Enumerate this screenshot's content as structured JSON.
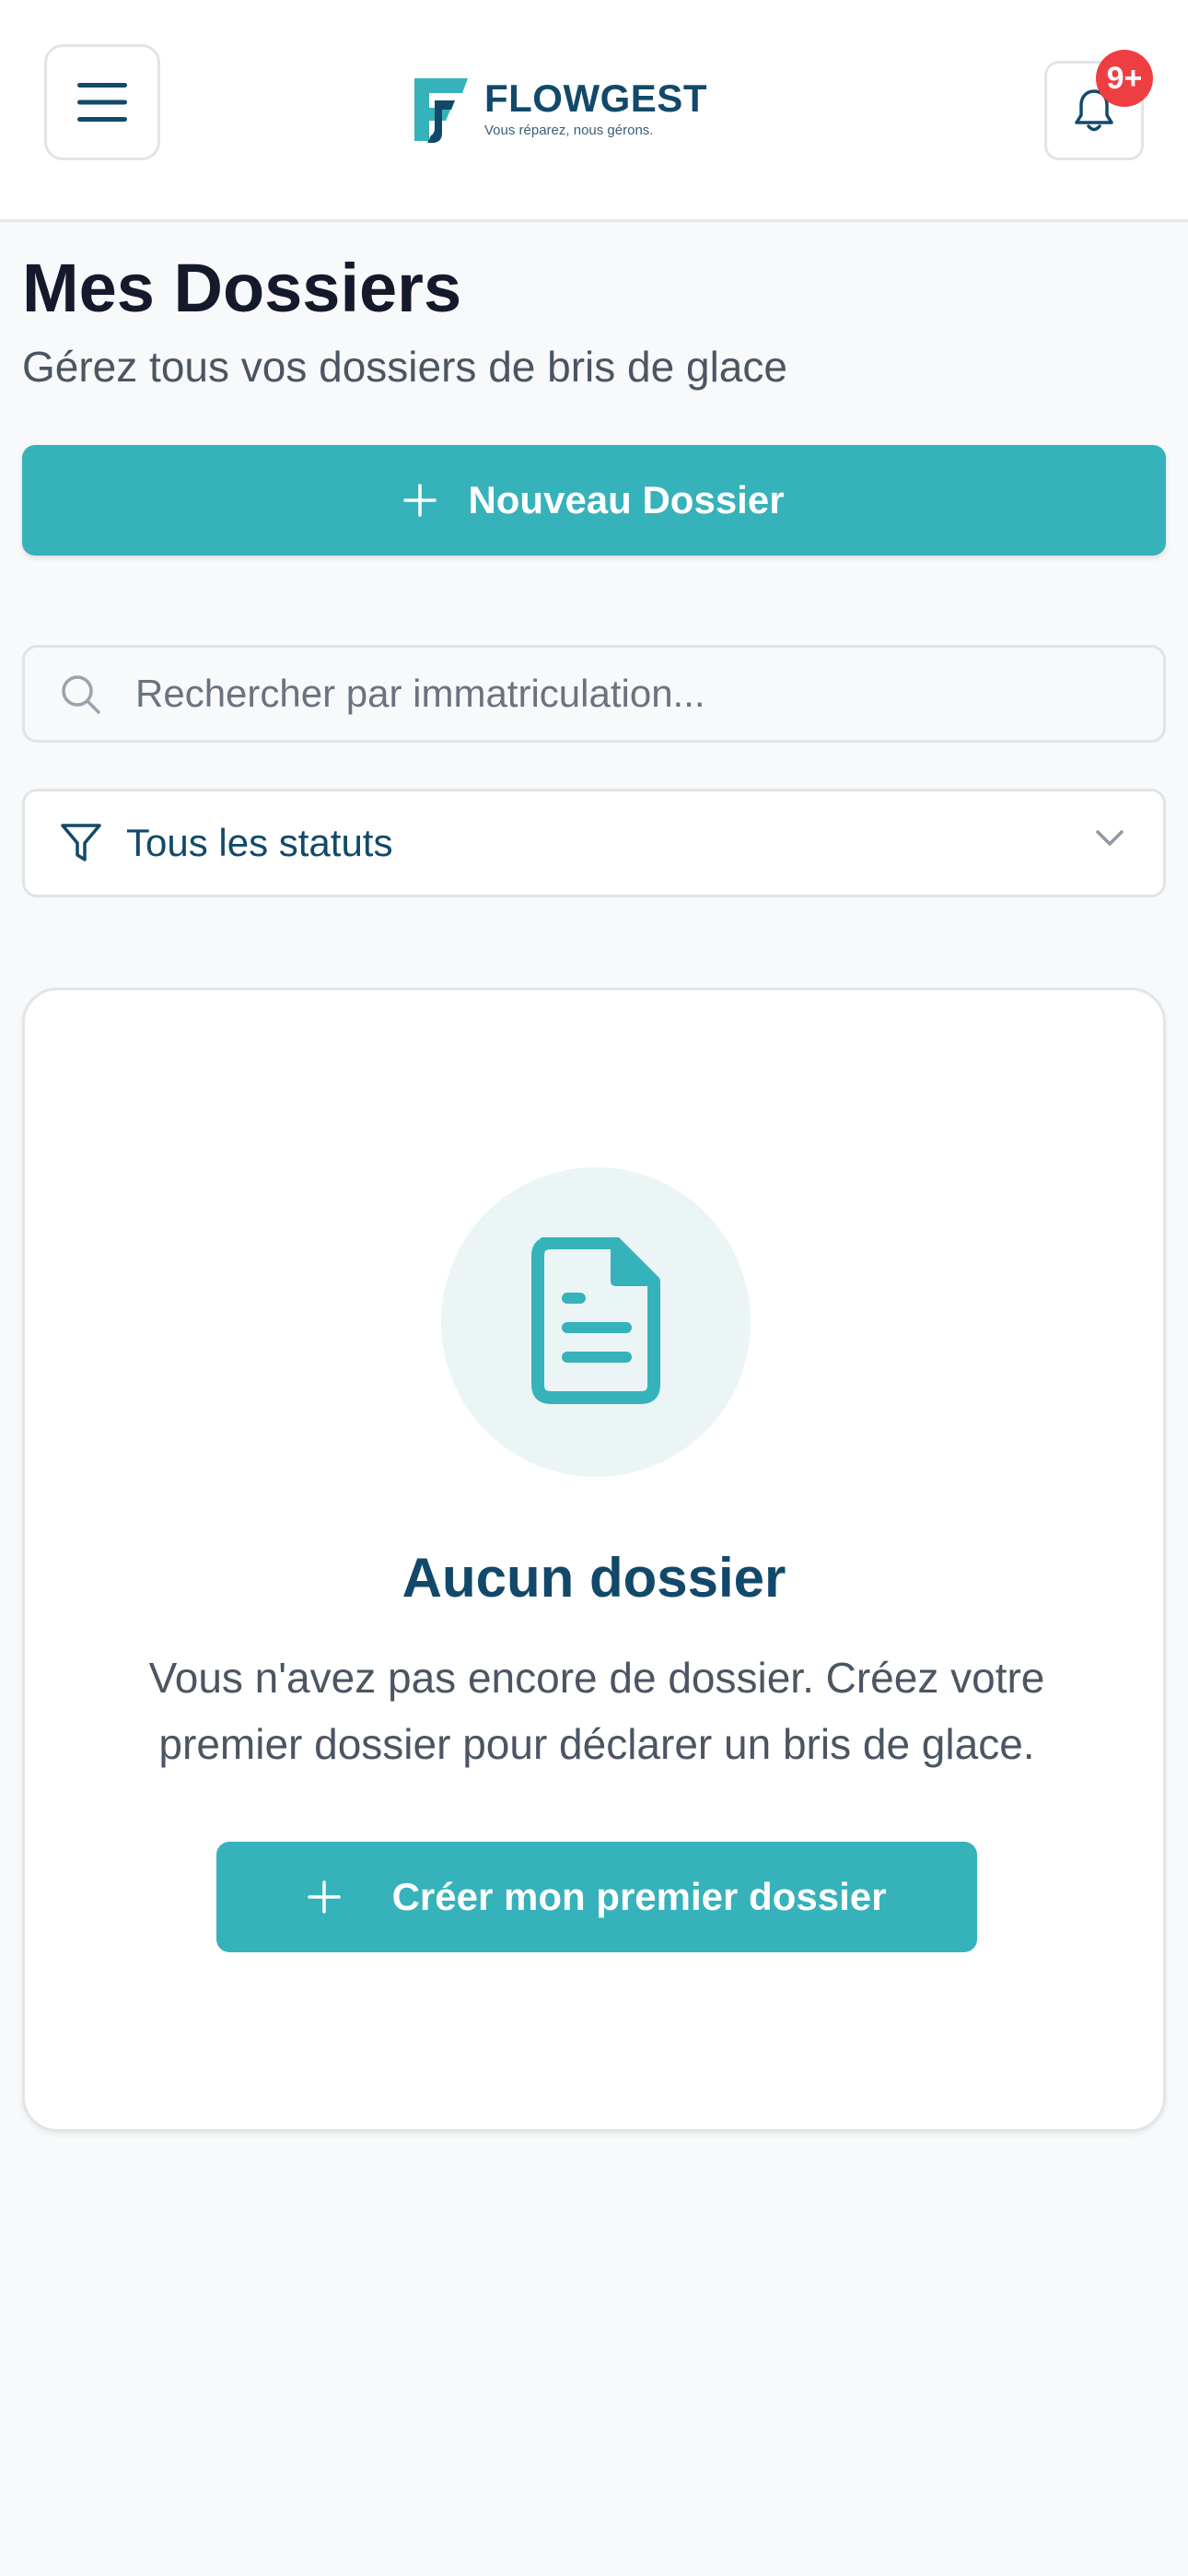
{
  "header": {
    "menu_icon": "hamburger-icon",
    "logo": {
      "name": "FLOWGEST",
      "tagline": "Vous réparez, nous gérons."
    },
    "notifications": {
      "icon": "bell-icon",
      "badge": "9+"
    }
  },
  "page": {
    "title": "Mes Dossiers",
    "subtitle": "Gérez tous vos dossiers de bris de glace"
  },
  "actions": {
    "new_folder_label": "Nouveau Dossier",
    "new_folder_icon": "plus-icon"
  },
  "search": {
    "placeholder": "Rechercher par immatriculation...",
    "value": "",
    "icon": "search-icon"
  },
  "filter": {
    "selected": "Tous les statuts",
    "icon": "filter-icon"
  },
  "empty_state": {
    "icon": "document-icon",
    "title": "Aucun dossier",
    "text": "Vous n'avez pas encore de dossier. Créez votre premier dossier pour déclarer un bris de glace.",
    "button_label": "Créer mon premier dossier"
  },
  "colors": {
    "accent": "#36b2ba",
    "brand_dark": "#12496a",
    "badge": "#ef3e42",
    "background": "#f7f9fa"
  }
}
